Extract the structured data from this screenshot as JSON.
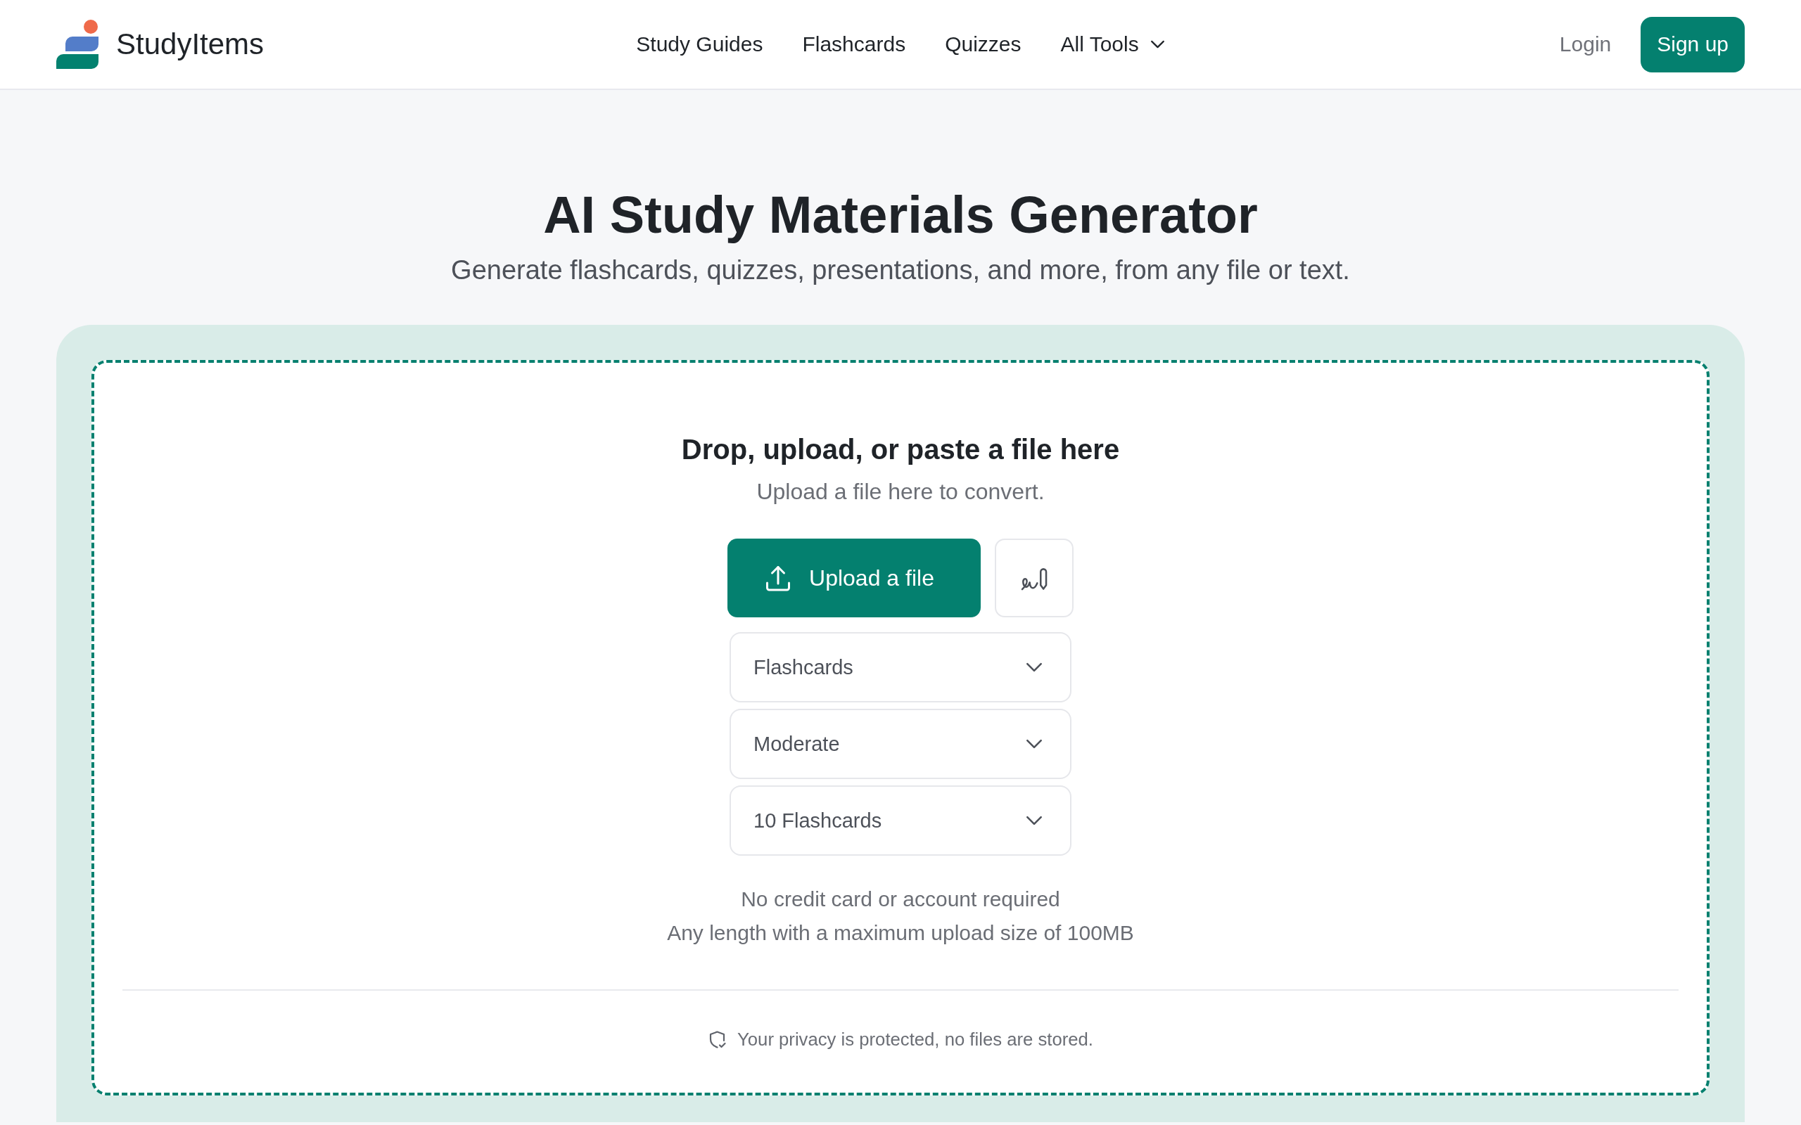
{
  "header": {
    "brand": "StudyItems",
    "nav": [
      {
        "label": "Study Guides",
        "kind": "link"
      },
      {
        "label": "Flashcards",
        "kind": "link"
      },
      {
        "label": "Quizzes",
        "kind": "link"
      },
      {
        "label": "All Tools",
        "kind": "menu"
      }
    ],
    "login": "Login",
    "signup": "Sign up"
  },
  "hero": {
    "title": "AI Study Materials Generator",
    "subtitle": "Generate flashcards, quizzes, presentations, and more, from any file or text."
  },
  "dropzone": {
    "heading": "Drop, upload, or paste a file here",
    "hint": "Upload a file here to convert.",
    "upload_button": "Upload a file",
    "selects": [
      "Flashcards",
      "Moderate",
      "10 Flashcards"
    ],
    "notes": [
      "No credit card or account required",
      "Any length with a maximum upload size of 100MB"
    ],
    "privacy": "Your privacy is protected, no files are stored."
  }
}
